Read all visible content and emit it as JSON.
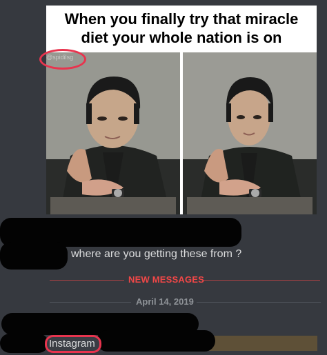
{
  "meme": {
    "caption_line1": "When you finally try that miracle",
    "caption_line2": "diet your whole nation is on",
    "watermark": "@spidilsg"
  },
  "chat": {
    "message_text": "where are you getting these from ?",
    "new_messages_label": "NEW MESSAGES",
    "date_label": "April 14, 2019",
    "instagram_text": "Instagram"
  },
  "colors": {
    "background": "#36393f",
    "new_messages": "#f04747",
    "highlight_bar": "#5e5037",
    "annotation_red": "#e8344e"
  }
}
